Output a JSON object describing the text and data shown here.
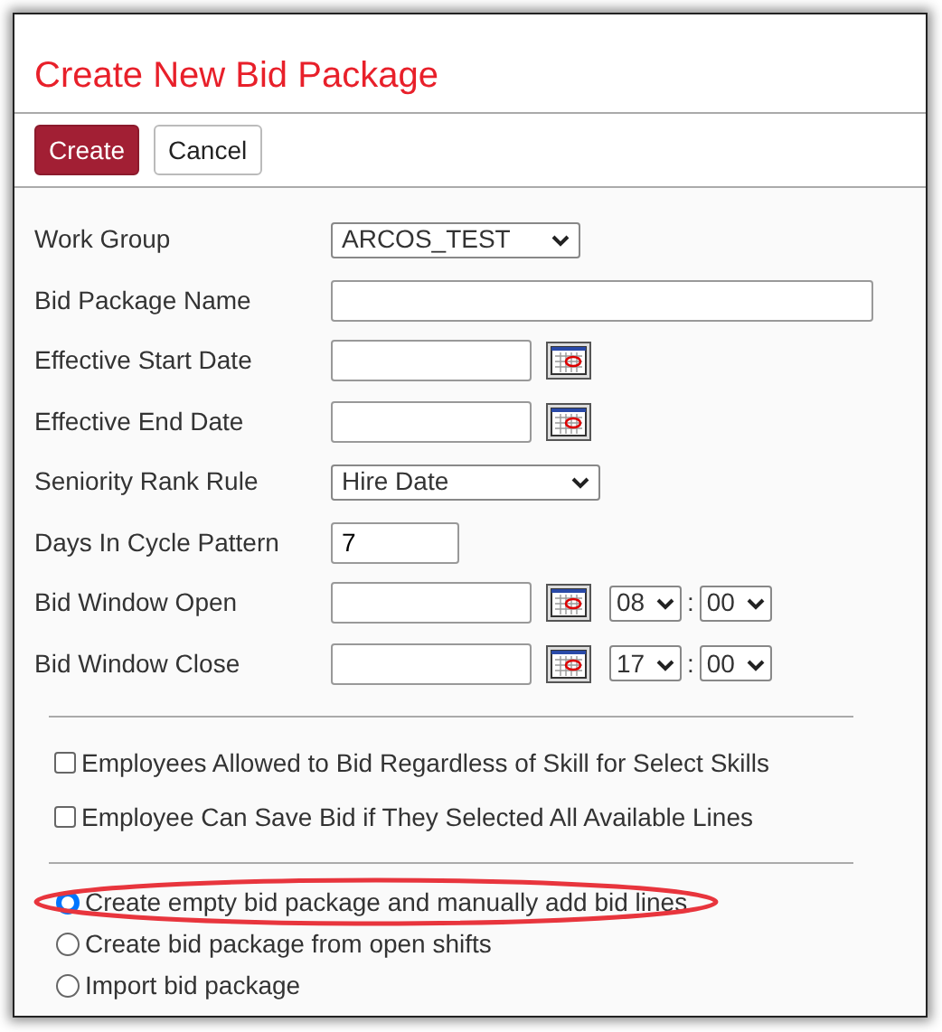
{
  "title": "Create New Bid Package",
  "buttons": [
    {
      "label": "Create",
      "kind": "primary"
    },
    {
      "label": "Cancel",
      "kind": "secondary"
    }
  ],
  "fields": [
    {
      "label": "Work Group",
      "kind": "select",
      "value": "ARCOS_TEST"
    },
    {
      "label": "Bid Package Name",
      "kind": "text"
    },
    {
      "label": "Effective Start Date",
      "kind": "date"
    },
    {
      "label": "Effective End Date",
      "kind": "date"
    },
    {
      "label": "Seniority Rank Rule",
      "kind": "select",
      "value": "Hire Date"
    },
    {
      "label": "Days In Cycle Pattern",
      "kind": "text",
      "value": "7"
    },
    {
      "label": "Bid Window Open",
      "kind": "datetime",
      "hour": "08",
      "separator": ":",
      "minute": "00"
    },
    {
      "label": "Bid Window Close",
      "kind": "datetime",
      "hour": "17",
      "separator": ":",
      "minute": "00"
    }
  ],
  "checkboxes": [
    {
      "label": "Employees Allowed to Bid Regardless of Skill for Select Skills",
      "checked": false
    },
    {
      "label": "Employee Can Save Bid if They Selected All Available Lines",
      "checked": false
    }
  ],
  "options": [
    {
      "label": "Create empty bid package and manually add bid lines",
      "selected": true,
      "circled": true
    },
    {
      "label": "Create bid package from open shifts",
      "selected": false,
      "circled": false
    },
    {
      "label": "Import bid package",
      "selected": false,
      "circled": false
    }
  ]
}
